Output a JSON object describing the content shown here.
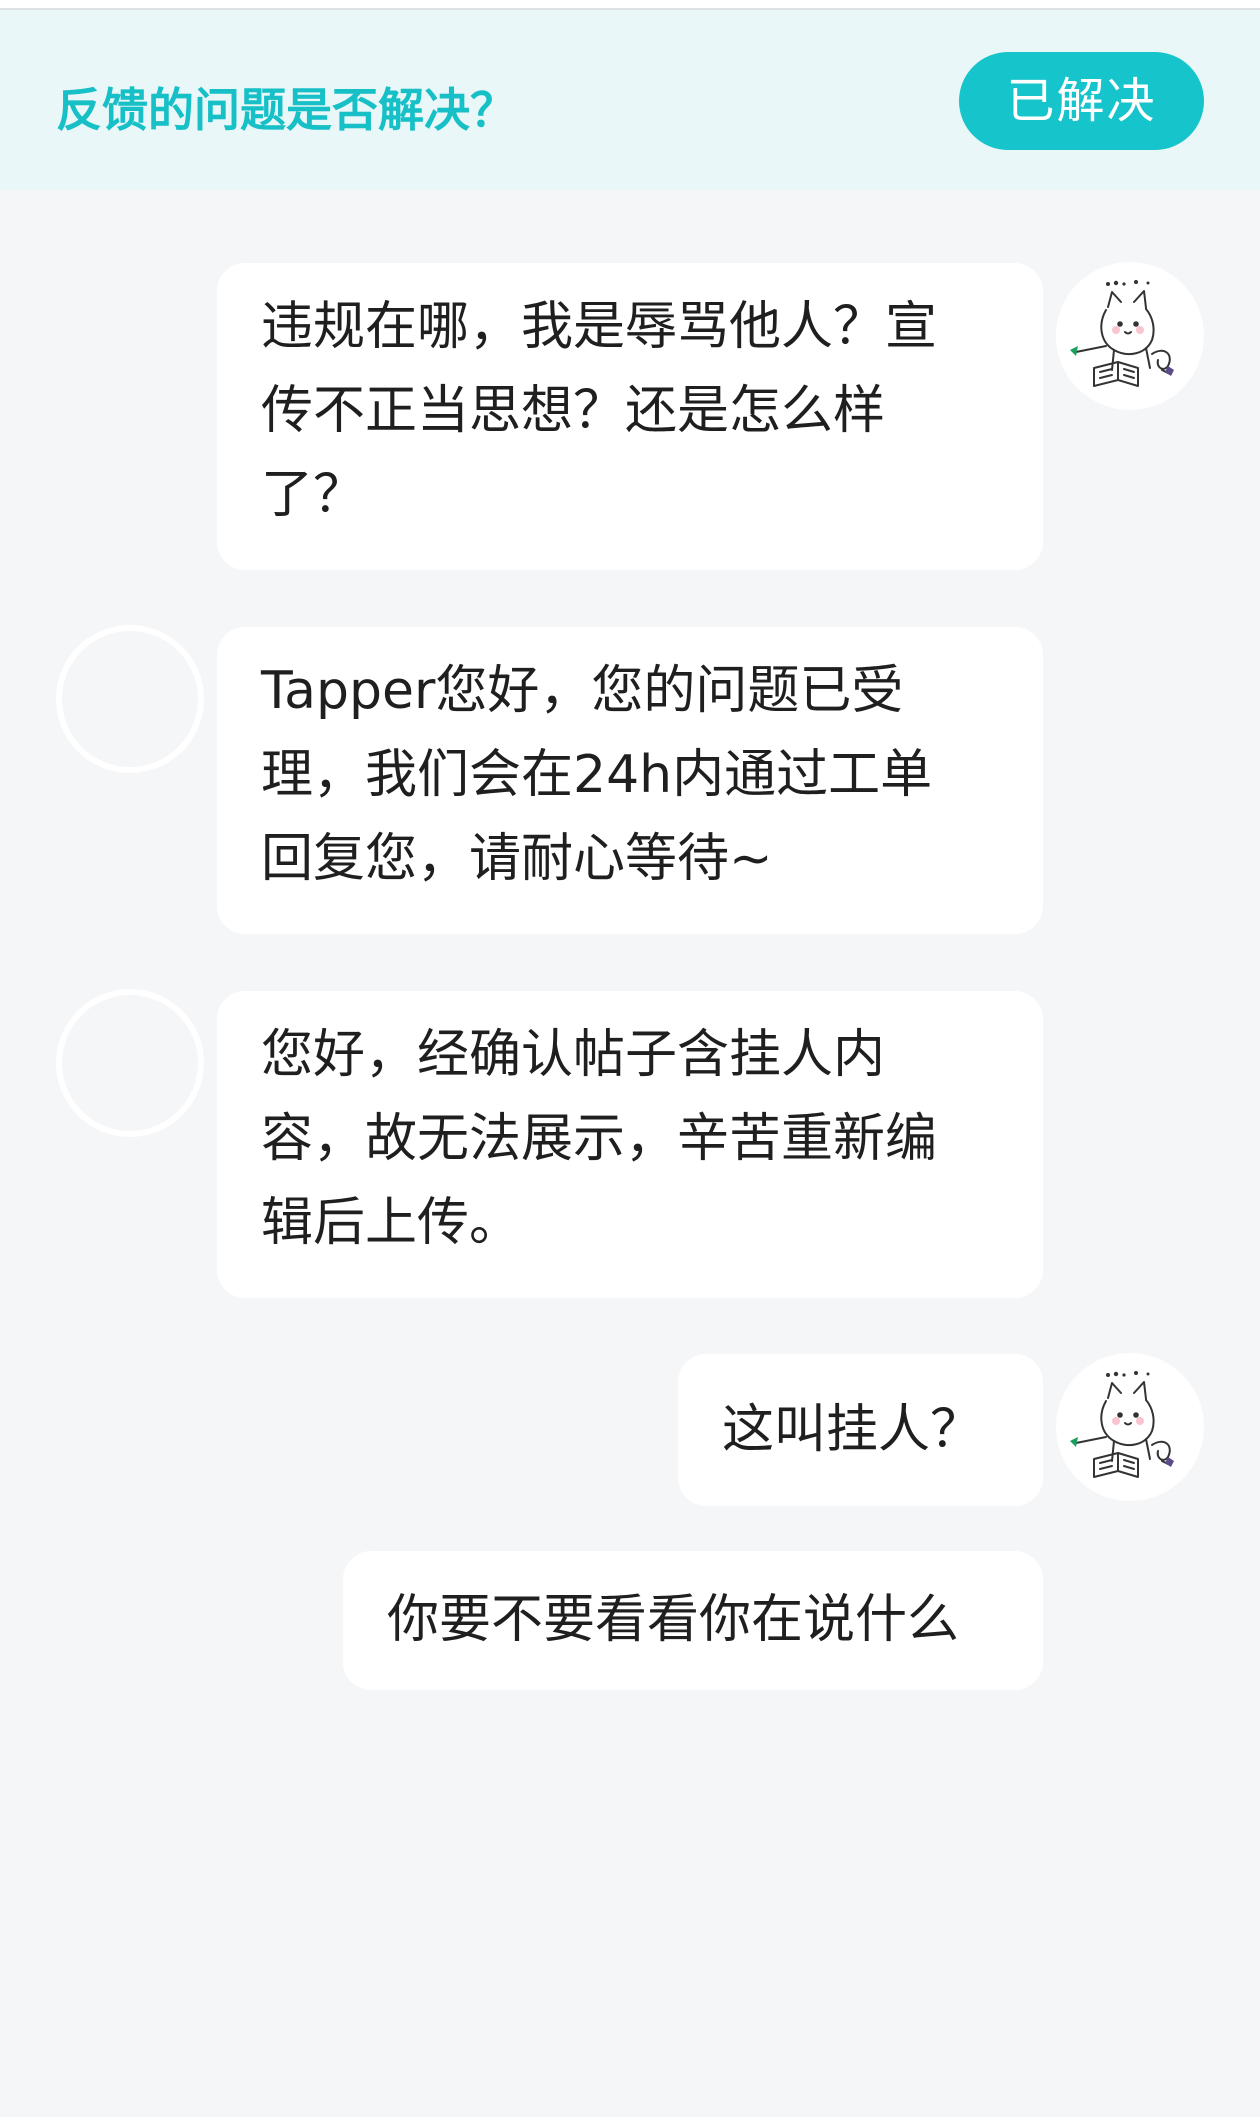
{
  "banner": {
    "question": "反馈的问题是否解决？",
    "resolved_label": "已解决"
  },
  "colors": {
    "accent": "#16c4cb",
    "accent_text": "#16c0c6",
    "banner_bg": "#e9f7f8",
    "page_bg": "#f5f6f8",
    "bubble_bg": "#ffffff",
    "text": "#1f1f1f"
  },
  "messages": [
    {
      "sender": "user",
      "text": "违规在哪，我是辱骂他人？宣\n传不正当思想？还是怎么样\n了？"
    },
    {
      "sender": "support",
      "text": "Tapper您好，您的问题已受\n理，我们会在24h内通过工单\n回复您，请耐心等待~"
    },
    {
      "sender": "support",
      "text": "您好，经确认帖子含挂人内\n容，故无法展示，辛苦重新编\n辑后上传。"
    },
    {
      "sender": "user",
      "text": "这叫挂人？"
    },
    {
      "sender": "user",
      "text": "你要不要看看你在说什么"
    }
  ],
  "icons": {
    "user_avatar": "cartoon-cat-avatar-icon",
    "support_avatar": "empty-circle-avatar-icon"
  }
}
